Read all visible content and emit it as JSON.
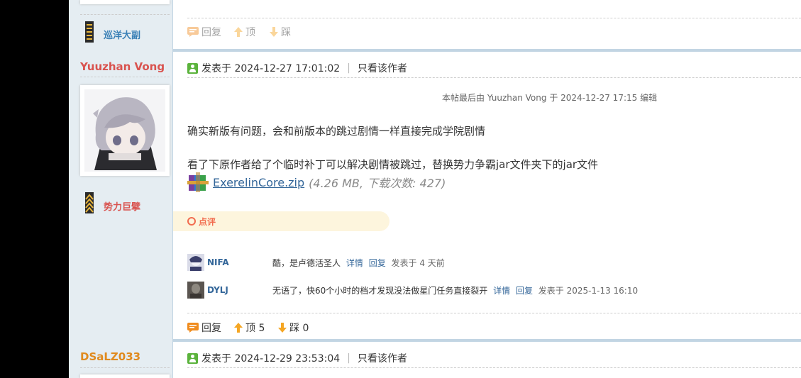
{
  "sidebar": {
    "user1": {
      "rank": "巡洋大副"
    },
    "user2": {
      "name": "Yuuzhan Vong",
      "rank": "势力巨擘"
    },
    "user3": {
      "name": "DSaLZ033"
    }
  },
  "prev_post": {
    "actions": {
      "reply": "回复",
      "up": "顶",
      "down": "踩"
    }
  },
  "post": {
    "posted": "发表于 2024-12-27 17:01:02",
    "only_author": "只看该作者",
    "edit_note": "本帖最后由 Yuuzhan Vong 于 2024-12-27 17:15 编辑",
    "line1": "确实新版有问题，会和前版本的跳过剧情一样直接完成学院剧情",
    "line2": "看了下原作者给了个临时补丁可以解决剧情被跳过，替换势力争霸jar文件夹下的jar文件",
    "attachment": {
      "name": "ExerelinCore.zip",
      "meta": "(4.26 MB, 下载次数: 427)"
    },
    "rate_label": "点评",
    "comments": [
      {
        "user": "NIFA",
        "text": "酷，是卢德活圣人",
        "detail": "详情",
        "reply": "回复",
        "time": "发表于 4 天前"
      },
      {
        "user": "DYLJ",
        "text": "无语了，快60个小时的档才发现没法做星门任务直接裂开",
        "detail": "详情",
        "reply": "回复",
        "time": "发表于 2025-1-13 16:10"
      }
    ],
    "actions": {
      "reply": "回复",
      "up": "顶 5",
      "down": "踩 0"
    }
  },
  "next_post": {
    "posted": "发表于 2024-12-29 23:53:04",
    "only_author": "只看该作者"
  }
}
